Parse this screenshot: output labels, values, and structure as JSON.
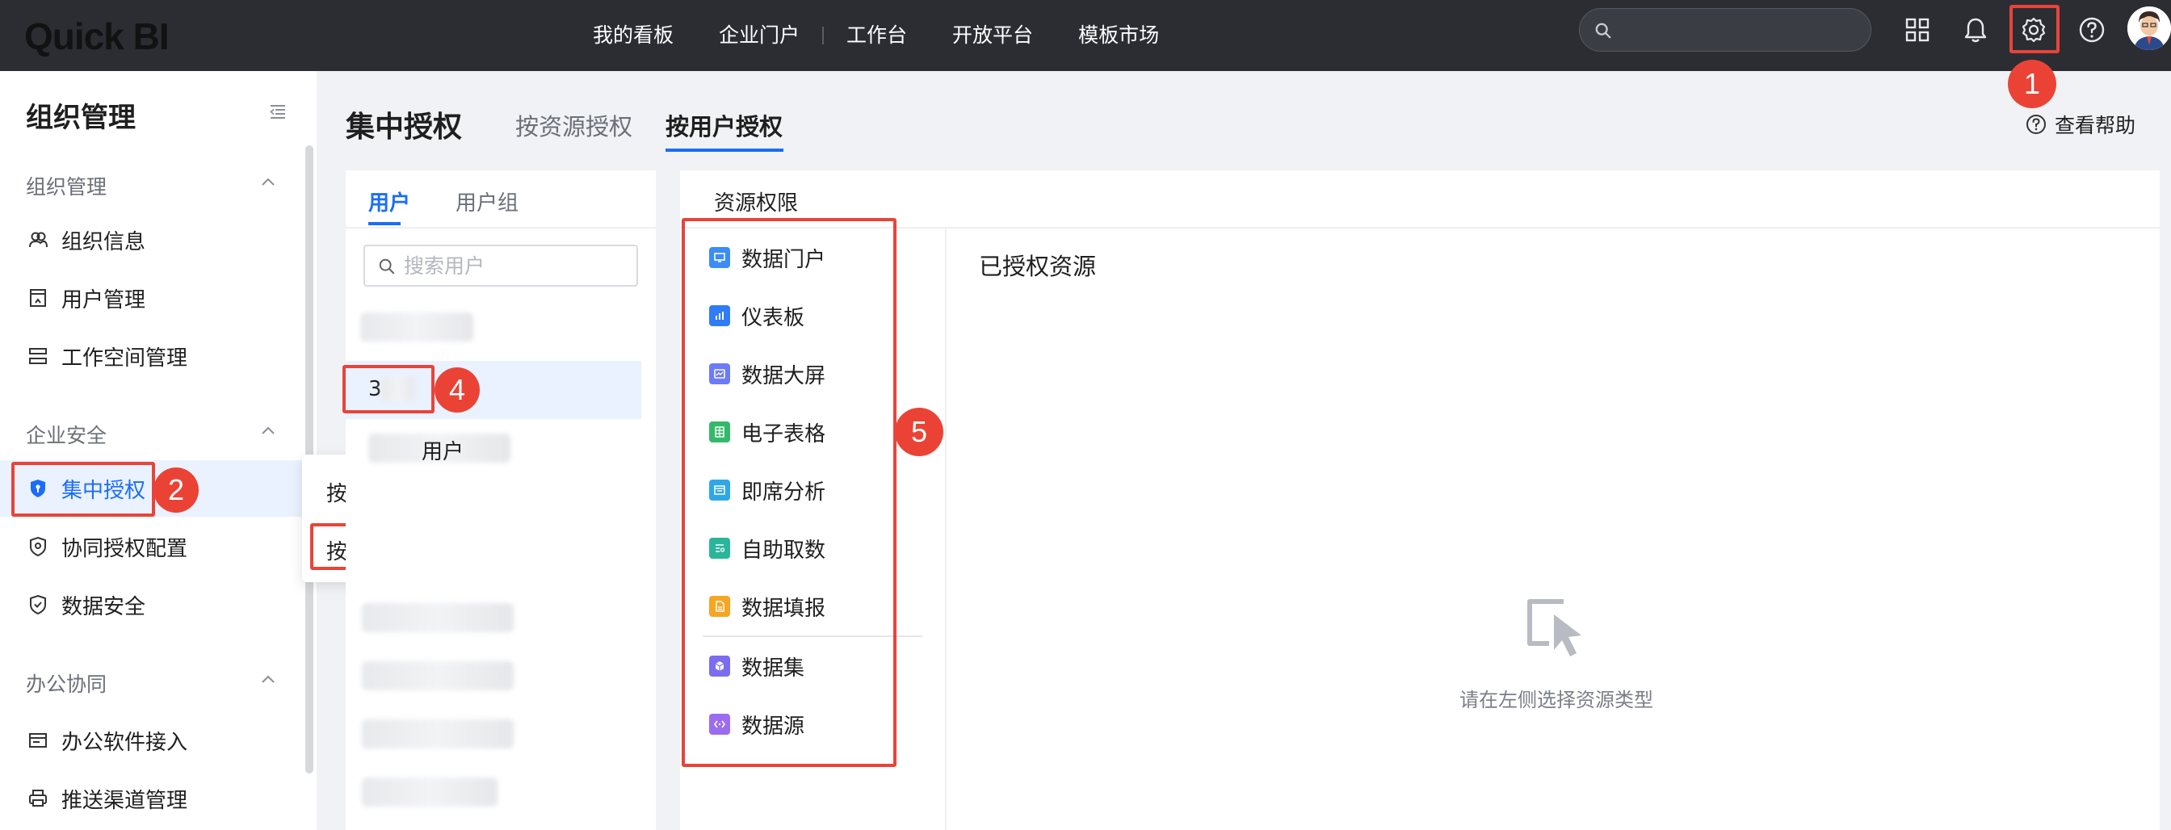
{
  "app": {
    "logo": "Quick BI"
  },
  "topnav": {
    "items": [
      "我的看板",
      "企业门户",
      "工作台",
      "开放平台",
      "模板市场"
    ]
  },
  "search": {
    "placeholder": ""
  },
  "sidebar": {
    "title": "组织管理",
    "groups": [
      {
        "label": "组织管理",
        "items": [
          "组织信息",
          "用户管理",
          "工作空间管理"
        ]
      },
      {
        "label": "企业安全",
        "items": [
          "集中授权",
          "协同授权配置",
          "数据安全"
        ]
      },
      {
        "label": "办公协同",
        "items": [
          "办公软件接入",
          "推送渠道管理"
        ]
      }
    ],
    "active_item": "集中授权"
  },
  "flyout": {
    "items": [
      "按资源授权",
      "按用户授权"
    ]
  },
  "header": {
    "title": "集中授权",
    "tabs": [
      "按资源授权",
      "按用户授权"
    ],
    "active_tab": "按用户授权",
    "help": "查看帮助"
  },
  "user_panel": {
    "tabs": [
      "用户",
      "用户组"
    ],
    "active_tab": "用户",
    "search_placeholder": "搜索用户",
    "selected_user": "3",
    "partial_user": "用户"
  },
  "resource_panel": {
    "title": "资源权限",
    "resources": [
      {
        "label": "数据门户",
        "color": "#3b8cf5"
      },
      {
        "label": "仪表板",
        "color": "#2f7cf6"
      },
      {
        "label": "数据大屏",
        "color": "#6c7bf7"
      },
      {
        "label": "电子表格",
        "color": "#34b86a"
      },
      {
        "label": "即席分析",
        "color": "#2ea7e8"
      },
      {
        "label": "自助取数",
        "color": "#2bb59a"
      },
      {
        "label": "数据填报",
        "color": "#f5a623"
      },
      {
        "label": "数据集",
        "color": "#7b6cf0"
      },
      {
        "label": "数据源",
        "color": "#9b6cf0"
      }
    ],
    "authorized_title": "已授权资源",
    "empty_text": "请在左侧选择资源类型"
  },
  "annotations": [
    "1",
    "2",
    "3",
    "4",
    "5"
  ],
  "colors": {
    "accent": "#1b6dfa",
    "annotation_red": "#e8443a",
    "topbar": "#2b2d33"
  }
}
